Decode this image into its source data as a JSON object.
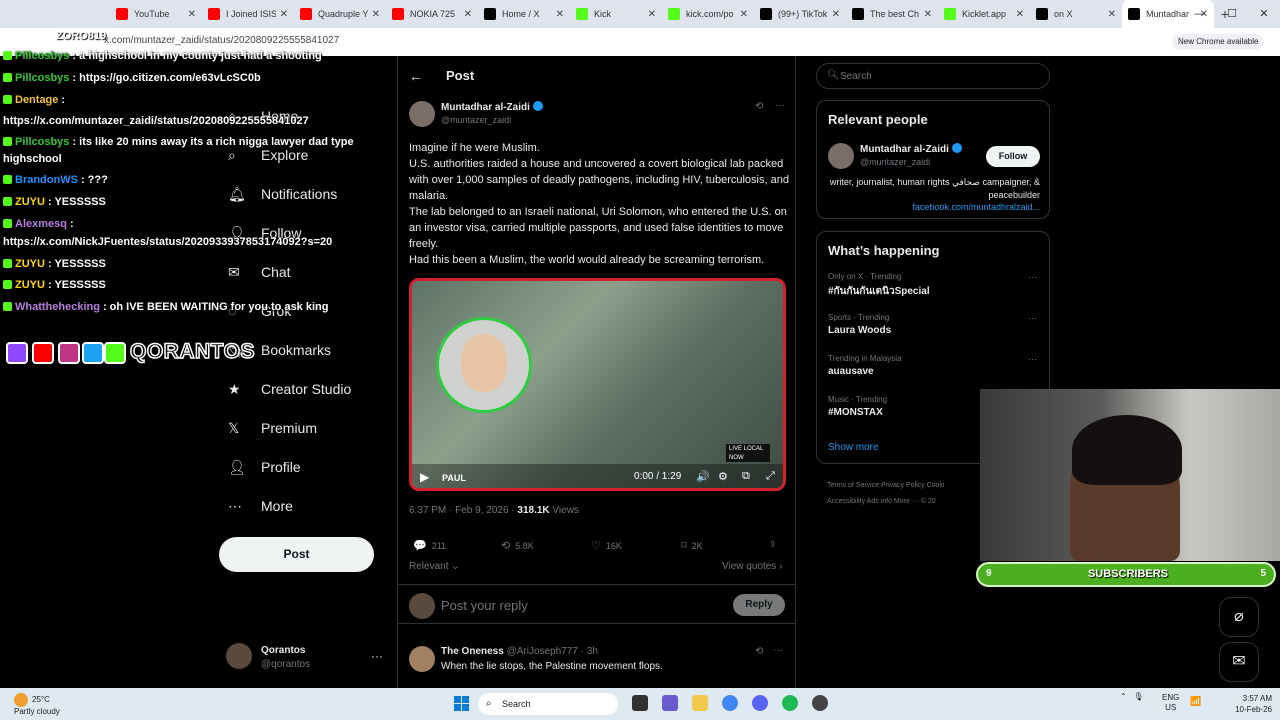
{
  "browser": {
    "tabs": [
      {
        "label": "YouTube",
        "color": "#ff0000"
      },
      {
        "label": "I Joined ISIS",
        "color": "#ff0000"
      },
      {
        "label": "Quadruple Y",
        "color": "#ff0000"
      },
      {
        "label": "NOKIA 725",
        "color": "#ff0000"
      },
      {
        "label": "Home / X",
        "color": "#000000"
      },
      {
        "label": "Kick",
        "color": "#53fc18"
      },
      {
        "label": "kick.com/po",
        "color": "#53fc18"
      },
      {
        "label": "(99+) TikTok",
        "color": "#000000"
      },
      {
        "label": "The best Ch",
        "color": "#000000"
      },
      {
        "label": "Kicklet.app",
        "color": "#53fc18"
      },
      {
        "label": "on X",
        "color": "#000000"
      },
      {
        "label": "Muntadhar",
        "color": "#000000"
      }
    ],
    "url": "x.com/muntazer_zaidi/status/2020809225555841027",
    "new_chrome": "New Chrome available"
  },
  "nav": {
    "items": [
      {
        "label": "Home"
      },
      {
        "label": "Explore"
      },
      {
        "label": "Notifications"
      },
      {
        "label": "Follow"
      },
      {
        "label": "Chat"
      },
      {
        "label": "Grok"
      },
      {
        "label": "Bookmarks"
      },
      {
        "label": "Creator Studio"
      },
      {
        "label": "Premium"
      },
      {
        "label": "Profile"
      },
      {
        "label": "More"
      }
    ],
    "post_button": "Post",
    "account_name": "Qorantos",
    "account_handle": "@qorantos",
    "account_more": "···"
  },
  "post": {
    "header": "Post",
    "author": "Muntadhar al-Zaidi",
    "handle": "@muntazer_zaidi",
    "paragraphs": [
      "Imagine if he were Muslim.",
      "U.S. authorities raided a house and uncovered a covert biological lab packed with over 1,000 samples of deadly pathogens, including HIV, tuberculosis, and malaria.",
      "The lab belonged to an Israeli national, Uri Solomon, who entered the U.S. on an investor visa, carried multiple passports, and used false identities to move freely.",
      "Had this been a Muslim, the world would already be screaming terrorism."
    ],
    "video_time": "0:00 / 1:29",
    "video_tag": "PAUL",
    "video_badge": "LIVE LOCAL NOW",
    "timestamp": "6:37 PM · Feb 9, 2026 · ",
    "views_count": "318.1K",
    "views_label": " Views",
    "replies": "211",
    "reposts": "5.8K",
    "likes": "16K",
    "bookmarks": "2K",
    "sort_label": "Relevant",
    "view_quotes": "View quotes",
    "reply_placeholder": "Post your reply",
    "reply_button": "Reply"
  },
  "reply": {
    "author": "The Oneness",
    "handle": "@AriJoseph777 · 3h",
    "text": "When the lie stops, the Palestine movement flops."
  },
  "sidebar": {
    "search_placeholder": "Search",
    "relevant_title": "Relevant people",
    "person_name": "Muntadhar al-Zaidi",
    "person_handle": "@muntazer_zaidi",
    "follow_label": "Follow",
    "bio": "writer, journalist, human rights صحافي campaigner, & peacebuilder",
    "bio_link": "facebook.com/muntadhralzaid...",
    "happening_title": "What’s happening",
    "trends": [
      {
        "context": "Only on X · Trending",
        "topic": "#กันกันกันเตนิวSpecial"
      },
      {
        "context": "Sports · Trending",
        "topic": "Laura Woods"
      },
      {
        "context": "Trending in Malaysia",
        "topic": "auausave"
      },
      {
        "context": "Music · Trending",
        "topic": "#MONSTAX"
      }
    ],
    "show_more": "Show more",
    "footer_line1": "Terms of Service   Privacy Policy   Cooki",
    "footer_line2": "Accessibility   Ads info   More ···   © 20"
  },
  "stream": {
    "chat": [
      {
        "user": "Pillcosbys",
        "color": "#32c832",
        "msg": ": a highschool in my county just had a shooting"
      },
      {
        "user": "Pillcosbys",
        "color": "#32c832",
        "msg": ": https://go.citizen.com/e63vLcSC0b"
      },
      {
        "user": "Dentage",
        "color": "#f0c040",
        "msg": ":"
      },
      {
        "user": "",
        "color": "#ffffff",
        "msg": "https://x.com/muntazer_zaidi/status/2020809225555841027"
      },
      {
        "user": "Pillcosbys",
        "color": "#32c832",
        "msg": ": its like 20 mins away its a rich nigga lawyer dad type"
      },
      {
        "user": "",
        "color": "#ffffff",
        "msg": "highschool"
      },
      {
        "user": "BrandonWS",
        "color": "#1e90ff",
        "msg": ": ???"
      },
      {
        "user": "ZUYU",
        "color": "#ffd700",
        "msg": ": YESSSSS"
      },
      {
        "user": "Alexmesq",
        "color": "#b57edc",
        "msg": ":"
      },
      {
        "user": "",
        "color": "#ffffff",
        "msg": "https://x.com/NickJFuentes/status/2020933937853174092?s=20"
      },
      {
        "user": "ZUYU",
        "color": "#ffd700",
        "msg": ": YESSSSS"
      },
      {
        "user": "ZUYU",
        "color": "#ffd700",
        "msg": ": YESSSSS"
      },
      {
        "user": "Whatthehecking",
        "color": "#b57edc",
        "msg": ": oh IVE BEEN WAITING for you to ask king"
      }
    ],
    "channel_name": "QORANTOS",
    "streamer_tag": "ZORO819",
    "subscribers_label": "SUBSCRIBERS",
    "sub_left": "9",
    "sub_right": "5"
  },
  "taskbar": {
    "temp": "25°C",
    "weather": "Partly cloudy",
    "search": "Search",
    "lang": "ENG",
    "region": "US",
    "time": "3:57 AM",
    "date": "10-Feb-26"
  }
}
